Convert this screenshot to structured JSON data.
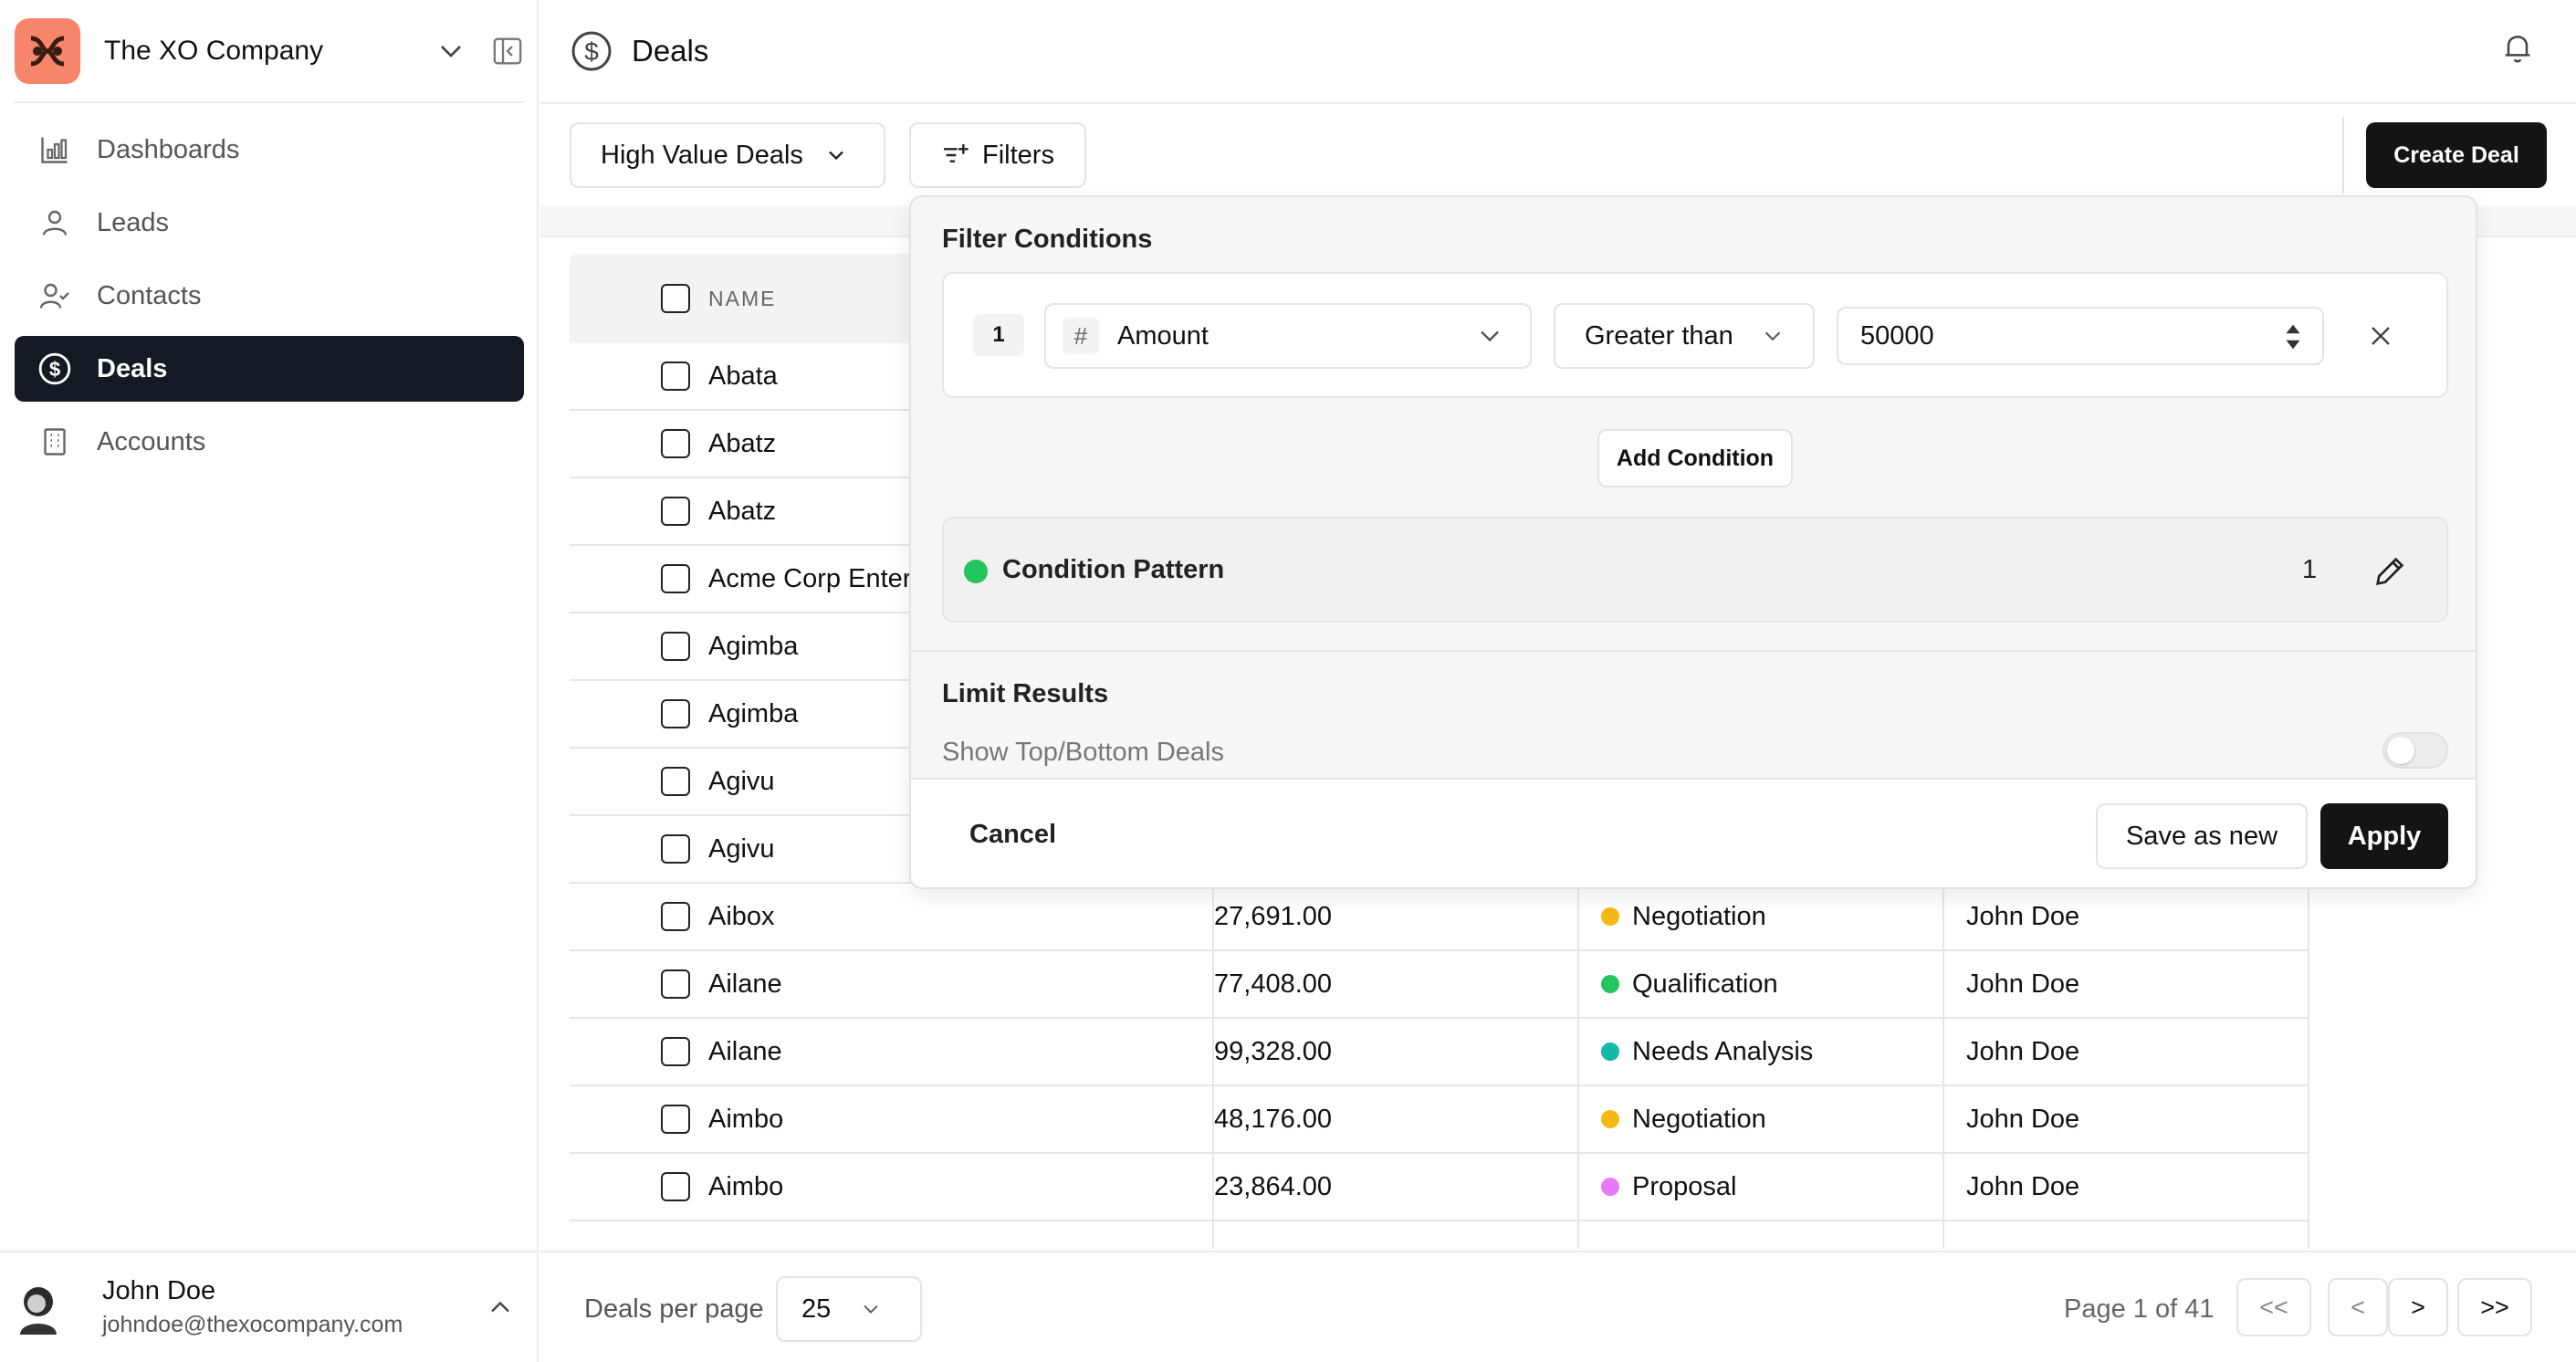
{
  "sidebar": {
    "company": "The XO Company",
    "items": [
      {
        "label": "Dashboards",
        "icon": "bar-chart-icon"
      },
      {
        "label": "Leads",
        "icon": "user-icon"
      },
      {
        "label": "Contacts",
        "icon": "user-check-icon"
      },
      {
        "label": "Deals",
        "icon": "dollar-circle-icon",
        "active": true
      },
      {
        "label": "Accounts",
        "icon": "building-icon"
      }
    ],
    "user": {
      "name": "John Doe",
      "email": "johndoe@thexocompany.com"
    }
  },
  "header": {
    "title": "Deals"
  },
  "toolbar": {
    "view": "High Value Deals",
    "filters_label": "Filters",
    "create_label": "Create Deal"
  },
  "table": {
    "columns": [
      "NAME"
    ],
    "hidden_rows": [
      "Abata",
      "Abatz",
      "Abatz",
      "Acme Corp Enterp",
      "Agimba",
      "Agimba",
      "Agivu",
      "Agivu"
    ],
    "rows": [
      {
        "name": "Aibox",
        "amount": "27,691.00",
        "stage": "Negotiation",
        "stage_color": "#f5b915",
        "owner": "John Doe"
      },
      {
        "name": "Ailane",
        "amount": "77,408.00",
        "stage": "Qualification",
        "stage_color": "#22c55e",
        "owner": "John Doe"
      },
      {
        "name": "Ailane",
        "amount": "99,328.00",
        "stage": "Needs Analysis",
        "stage_color": "#14b8a6",
        "owner": "John Doe"
      },
      {
        "name": "Aimbo",
        "amount": "48,176.00",
        "stage": "Negotiation",
        "stage_color": "#f5b915",
        "owner": "John Doe"
      },
      {
        "name": "Aimbo",
        "amount": "23,864.00",
        "stage": "Proposal",
        "stage_color": "#e879f9",
        "owner": "John Doe"
      }
    ]
  },
  "filter_popover": {
    "title": "Filter Conditions",
    "condition": {
      "index": "1",
      "field": "Amount",
      "operator": "Greater than",
      "value": "50000"
    },
    "add_condition_label": "Add Condition",
    "pattern_label": "Condition Pattern",
    "pattern_value": "1",
    "limit_title": "Limit Results",
    "limit_sub": "Show Top/Bottom Deals",
    "limit_enabled": false,
    "cancel_label": "Cancel",
    "save_new_label": "Save as new",
    "apply_label": "Apply"
  },
  "footer": {
    "per_page_label": "Deals per page",
    "per_page_value": "25",
    "page_info": "Page 1 of 41",
    "first": "<<",
    "prev": "<",
    "next": ">",
    "last": ">>"
  }
}
